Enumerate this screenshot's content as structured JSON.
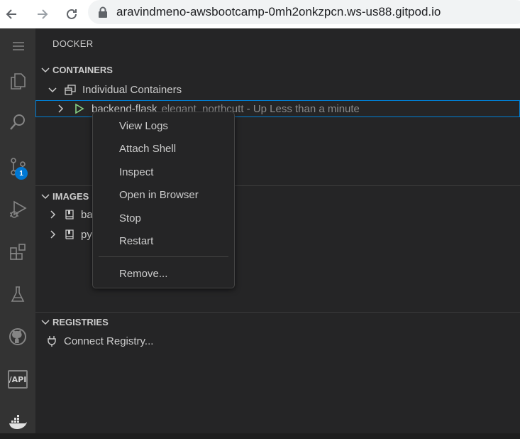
{
  "browser": {
    "url": "aravindmeno-awsbootcamp-0mh2onkzpcn.ws-us88.gitpod.io"
  },
  "activity_bar": {
    "scm_badge": "1",
    "api_label": "/API"
  },
  "sidebar": {
    "title": "DOCKER",
    "containers": {
      "header": "CONTAINERS",
      "group_label": "Individual Containers",
      "container_name": "backend-flask",
      "container_detail": "elegant_northcutt - Up Less than a minute"
    },
    "images": {
      "header": "IMAGES",
      "items": [
        {
          "label": "ba"
        },
        {
          "label": "py"
        }
      ]
    },
    "registries": {
      "header": "REGISTRIES",
      "connect_label": "Connect Registry..."
    }
  },
  "context_menu": {
    "items": [
      {
        "label": "View Logs"
      },
      {
        "label": "Attach Shell"
      },
      {
        "label": "Inspect"
      },
      {
        "label": "Open in Browser"
      },
      {
        "label": "Stop"
      },
      {
        "label": "Restart"
      },
      {
        "label": "Remove..."
      }
    ]
  },
  "colors": {
    "accent": "#007fd4",
    "badge": "#0078d4",
    "running_icon": "#89d185"
  }
}
